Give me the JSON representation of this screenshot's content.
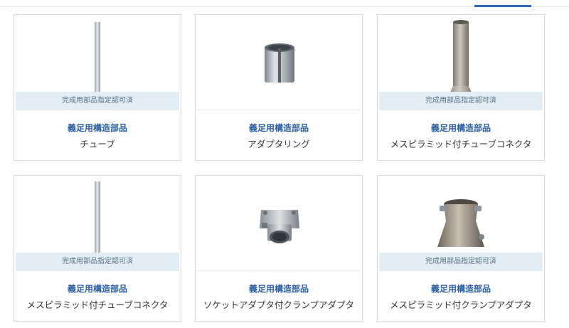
{
  "products": [
    {
      "certification": "完成用部品指定認可済",
      "category": "義足用構造部品",
      "name": "チューブ",
      "icon": "tube-icon"
    },
    {
      "certification": "",
      "category": "義足用構造部品",
      "name": "アダプタリング",
      "icon": "adapter-ring-icon"
    },
    {
      "certification": "完成用部品指定認可済",
      "category": "義足用構造部品",
      "name": "メスピラミッド付チューブコネクタ",
      "icon": "tube-connector-icon"
    },
    {
      "certification": "完成用部品指定認可済",
      "category": "義足用構造部品",
      "name": "メスピラミッド付チューブコネクタ",
      "icon": "tube-connector-long-icon"
    },
    {
      "certification": "",
      "category": "義足用構造部品",
      "name": "ソケットアダプタ付クランプアダプタ",
      "icon": "socket-clamp-adapter-icon"
    },
    {
      "certification": "完成用部品指定認可済",
      "category": "義足用構造部品",
      "name": "メスピラミッド付クランプアダプタ",
      "icon": "pyramid-clamp-adapter-icon"
    }
  ]
}
